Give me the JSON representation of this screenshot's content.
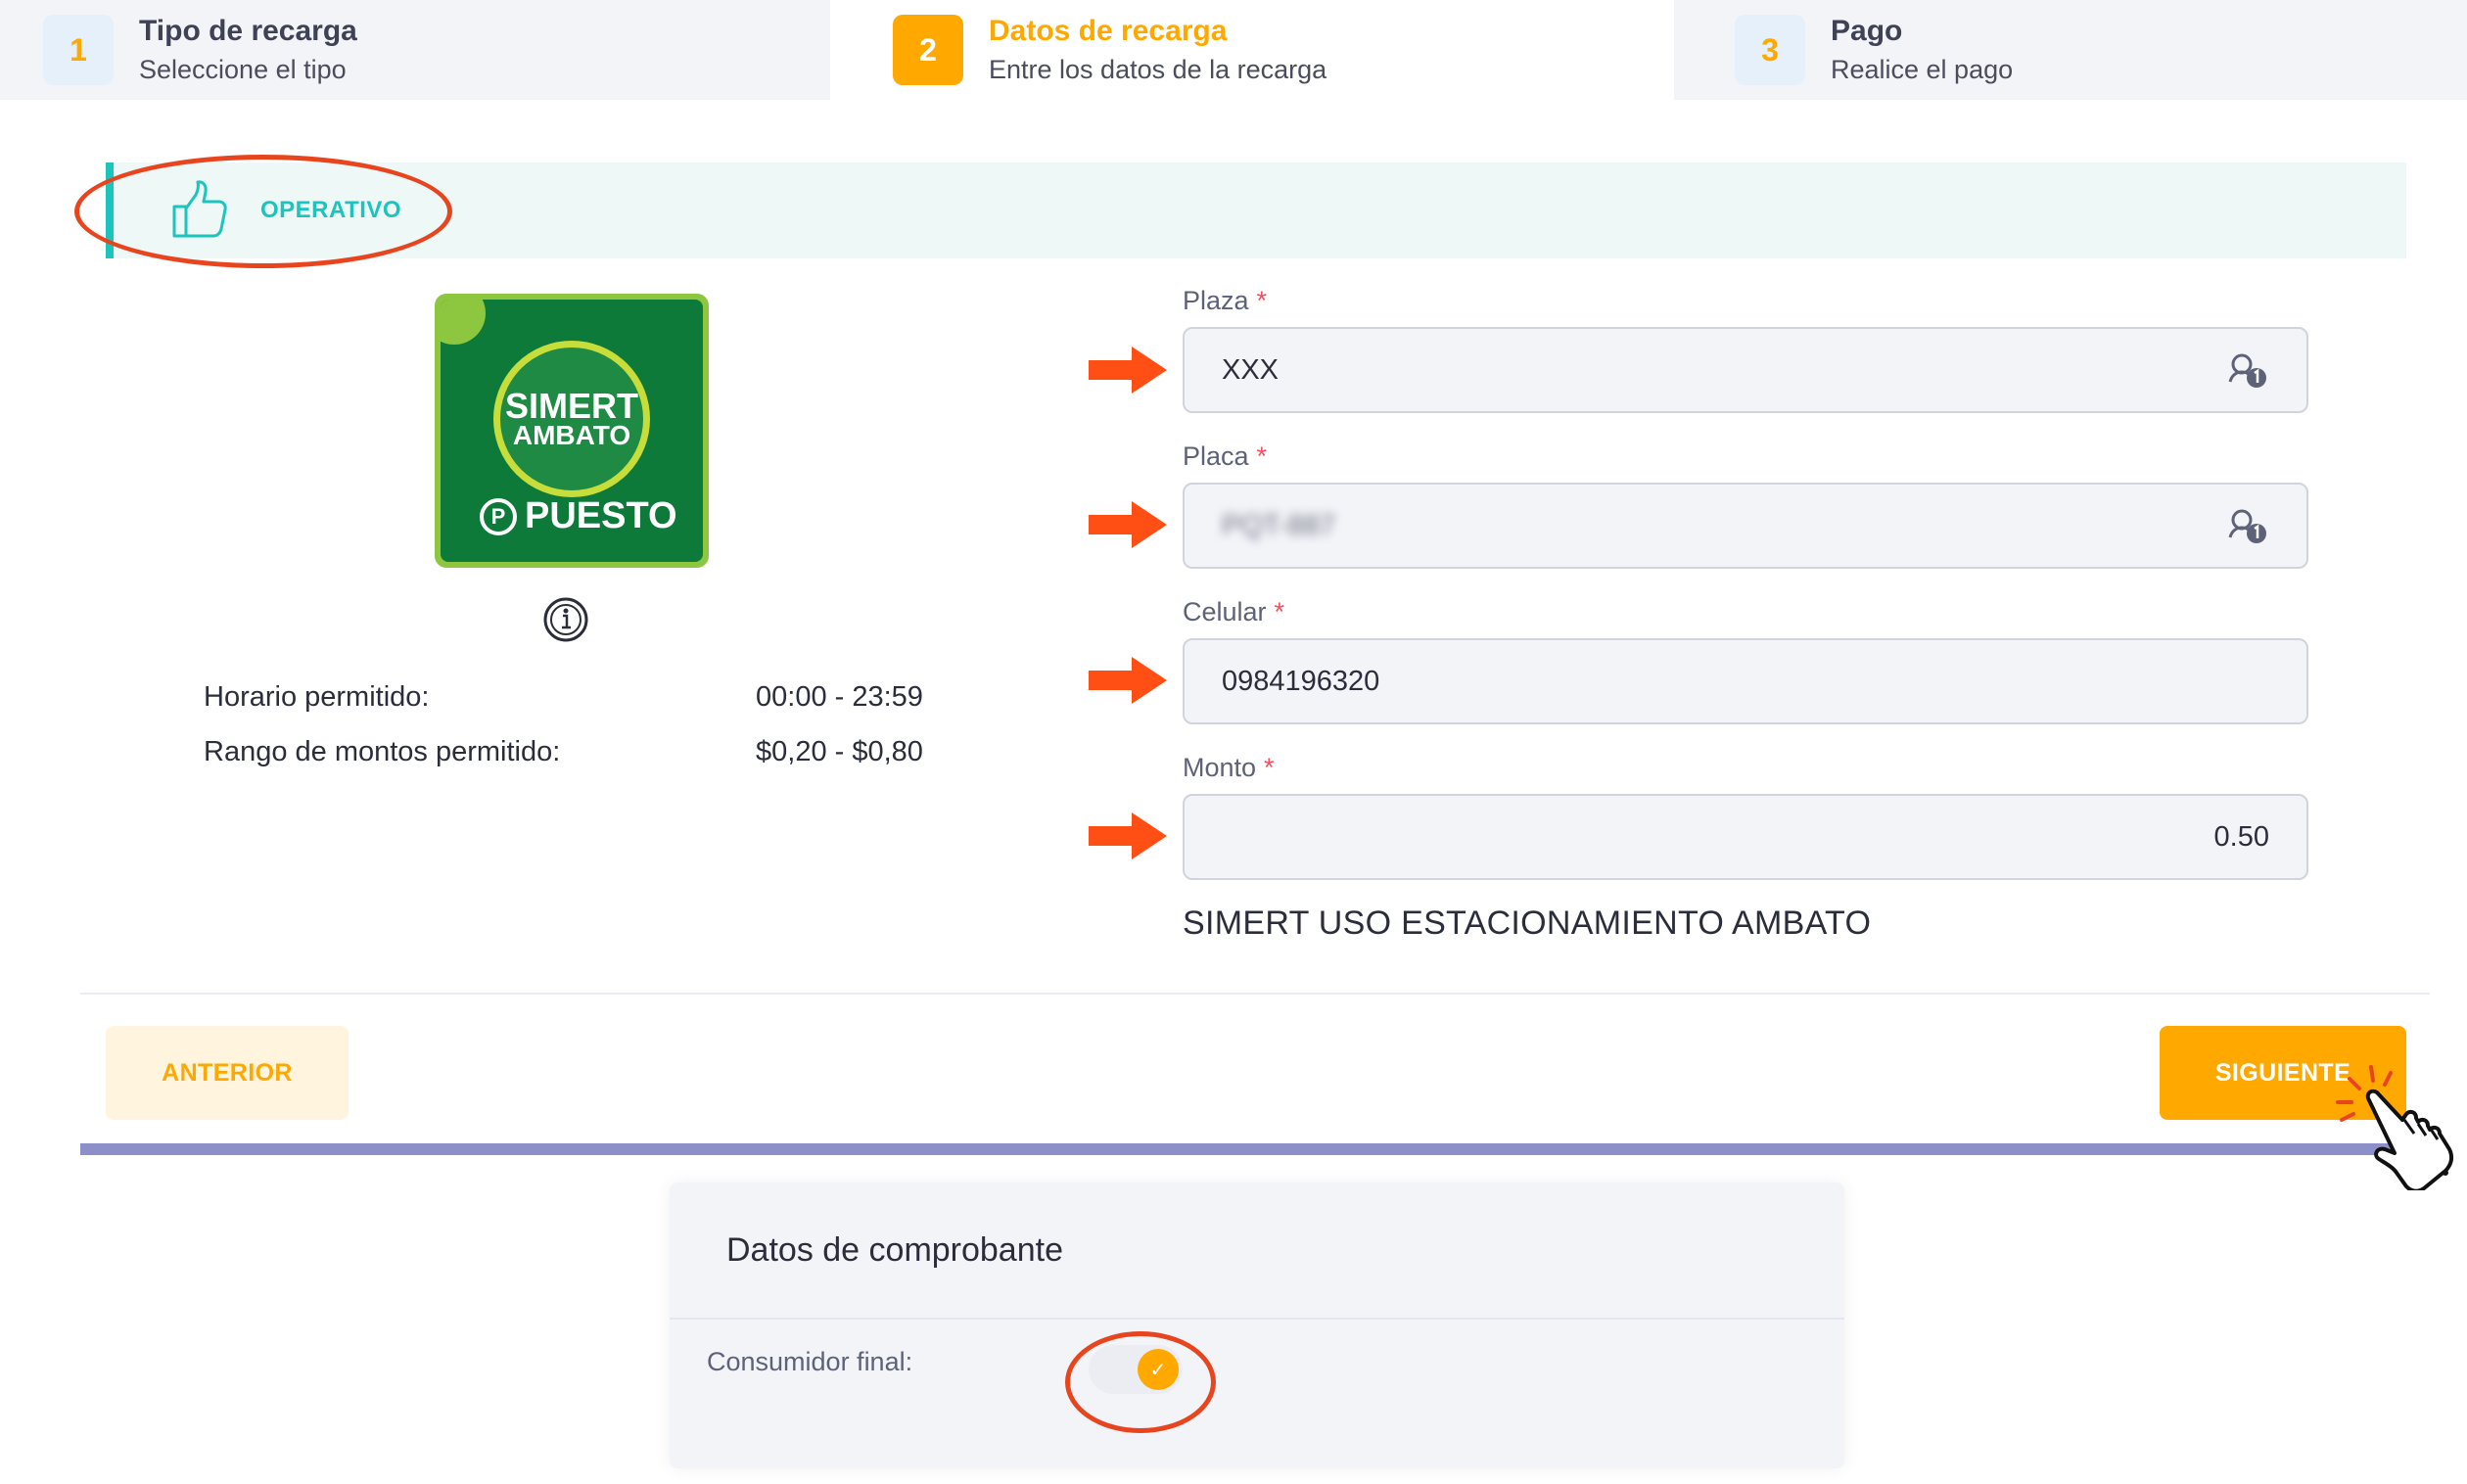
{
  "stepper": {
    "steps": [
      {
        "number": "1",
        "title": "Tipo de recarga",
        "subtitle": "Seleccione el tipo"
      },
      {
        "number": "2",
        "title": "Datos de recarga",
        "subtitle": "Entre los datos de la recarga"
      },
      {
        "number": "3",
        "title": "Pago",
        "subtitle": "Realice el pago"
      }
    ],
    "active_step": 2
  },
  "status": {
    "label": "OPERATIVO",
    "icon": "thumbs-up-icon"
  },
  "logo": {
    "line1": "SIMERT",
    "line2": "AMBATO",
    "pin": "P",
    "word": "PUESTO"
  },
  "info": {
    "schedule_label": "Horario permitido:",
    "schedule_value": "00:00 - 23:59",
    "range_label": "Rango de montos permitido:",
    "range_value": "$0,20 - $0,80"
  },
  "form": {
    "plaza": {
      "label": "Plaza",
      "required_mark": "*",
      "value": "XXX"
    },
    "placa": {
      "label": "Placa",
      "required_mark": "*",
      "value": "PQT-887"
    },
    "celular": {
      "label": "Celular",
      "required_mark": "*",
      "value": "0984196320"
    },
    "monto": {
      "label": "Monto",
      "required_mark": "*",
      "value": "0.50"
    }
  },
  "service_name": "SIMERT USO ESTACIONAMIENTO AMBATO",
  "buttons": {
    "prev": "ANTERIOR",
    "next": "SIGUIENTE"
  },
  "comprobante": {
    "title": "Datos de comprobante",
    "consumer_label": "Consumidor final:",
    "consumer_final": true
  },
  "colors": {
    "accent": "#ffa800",
    "status": "#1bc5bd",
    "annotation": "#e8451f",
    "divider_bar": "#8d8fc8"
  }
}
